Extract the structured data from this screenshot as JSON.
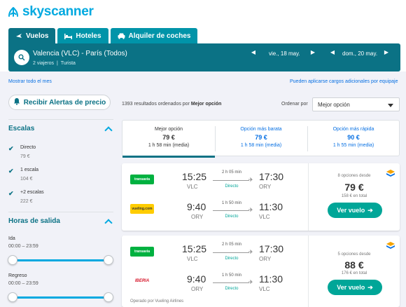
{
  "brand": {
    "name": "skyscanner",
    "color": "#00a9e0"
  },
  "tabs": [
    {
      "label": "Vuelos",
      "icon": "plane-icon",
      "active": true
    },
    {
      "label": "Hoteles",
      "icon": "bed-icon",
      "active": false
    },
    {
      "label": "Alquiler de coches",
      "icon": "car-icon",
      "active": false
    }
  ],
  "search": {
    "route": "Valencia (VLC) - París (Todos)",
    "travelers": "2 viajeros",
    "cabin": "Turista",
    "outbound_date": "vie., 18 may.",
    "return_date": "dom., 20 may."
  },
  "links": {
    "show_month": "Mostrar todo el mes",
    "extra_fees": "Pueden aplicarse cargos adicionales por equipaje"
  },
  "alerts_button": "Recibir Alertas de precio",
  "results": {
    "count_prefix": "1393 resultados ordenados por",
    "count_sort": "Mejor opción",
    "order_label": "Ordenar por",
    "order_value": "Mejor opción"
  },
  "filters": {
    "stops": {
      "title": "Escalas",
      "options": [
        {
          "label": "Directo",
          "price": "79 €",
          "checked": true
        },
        {
          "label": "1 escala",
          "price": "104 €",
          "checked": true
        },
        {
          "label": "+2 escalas",
          "price": "222 €",
          "checked": true
        }
      ]
    },
    "departure": {
      "title": "Horas de salida",
      "outbound_label": "Ida",
      "outbound_range": "00:00 – 23:59",
      "return_label": "Regreso",
      "return_range": "00:00 – 23:59"
    }
  },
  "sort_tabs": [
    {
      "title": "Mejor opción",
      "price": "79 €",
      "duration": "1 h 58 min (media)",
      "selected": true
    },
    {
      "title": "Opción más barata",
      "price": "79 €",
      "duration": "1 h 58 min (media)",
      "selected": false
    },
    {
      "title": "Opción más rápida",
      "price": "90 €",
      "duration": "1 h 55 min (media)",
      "selected": false
    }
  ],
  "cards": [
    {
      "legs": [
        {
          "airline": "transavia",
          "dep_time": "15:25",
          "dep_airport": "VLC",
          "duration": "2 h 05 min",
          "stops": "Directo",
          "arr_time": "17:30",
          "arr_airport": "ORY"
        },
        {
          "airline": "vueling.com",
          "dep_time": "9:40",
          "dep_airport": "ORY",
          "duration": "1 h 50 min",
          "stops": "Directo",
          "arr_time": "11:30",
          "arr_airport": "VLC"
        }
      ],
      "options": "8 opciones desde",
      "price": "79 €",
      "total": "158 € en total",
      "cta": "Ver vuelo"
    },
    {
      "legs": [
        {
          "airline": "transavia",
          "dep_time": "15:25",
          "dep_airport": "VLC",
          "duration": "2 h 05 min",
          "stops": "Directo",
          "arr_time": "17:30",
          "arr_airport": "ORY"
        },
        {
          "airline": "IBERIA",
          "dep_time": "9:40",
          "dep_airport": "ORY",
          "duration": "1 h 50 min",
          "stops": "Directo",
          "arr_time": "11:30",
          "arr_airport": "VLC"
        }
      ],
      "options": "5 opciones desde",
      "price": "88 €",
      "total": "176 € en total",
      "cta": "Ver vuelo",
      "operated_by": "Operado por Vueling Airlines"
    }
  ]
}
